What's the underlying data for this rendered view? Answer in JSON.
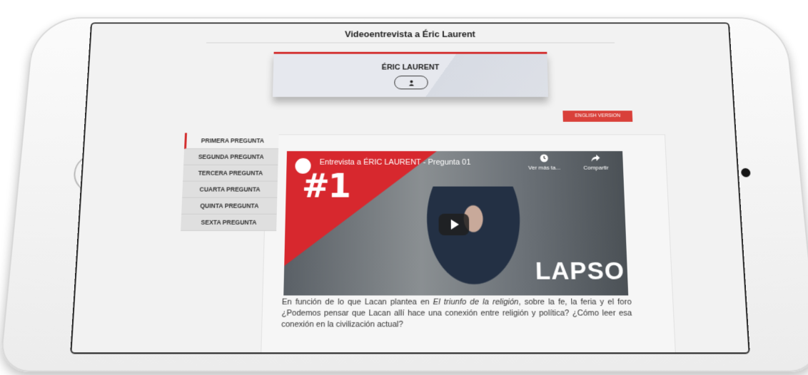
{
  "page": {
    "title": "Videoentrevista a Éric Laurent"
  },
  "profile": {
    "name": "ÉRIC LAURENT",
    "avatar_icon": "user-icon"
  },
  "actions": {
    "english_version": "ENGLISH VERSION"
  },
  "questions": [
    {
      "label": "PRIMERA PREGUNTA",
      "active": true
    },
    {
      "label": "SEGUNDA PREGUNTA",
      "active": false
    },
    {
      "label": "TERCERA PREGUNTA",
      "active": false
    },
    {
      "label": "CUARTA PREGUNTA",
      "active": false
    },
    {
      "label": "QUINTA PREGUNTA",
      "active": false
    },
    {
      "label": "SEXTA PREGUNTA",
      "active": false
    }
  ],
  "video": {
    "title": "Entrevista a ÉRIC LAURENT - Pregunta 01",
    "overlay_number": "#1",
    "watch_later": "Ver más ta...",
    "share": "Compartir",
    "watermark": "LAPSO"
  },
  "description": {
    "part1": "En función de lo que Lacan plantea en ",
    "italic": "El triunfo de la religión",
    "part2": ", sobre la fe, la feria y el foro ¿Podemos pensar que Lacan allí hace una conexión entre religión y política? ¿Cómo leer esa conexión en la civilización actual?"
  },
  "colors": {
    "accent": "#d32f2f",
    "english_button": "#d9403a"
  }
}
